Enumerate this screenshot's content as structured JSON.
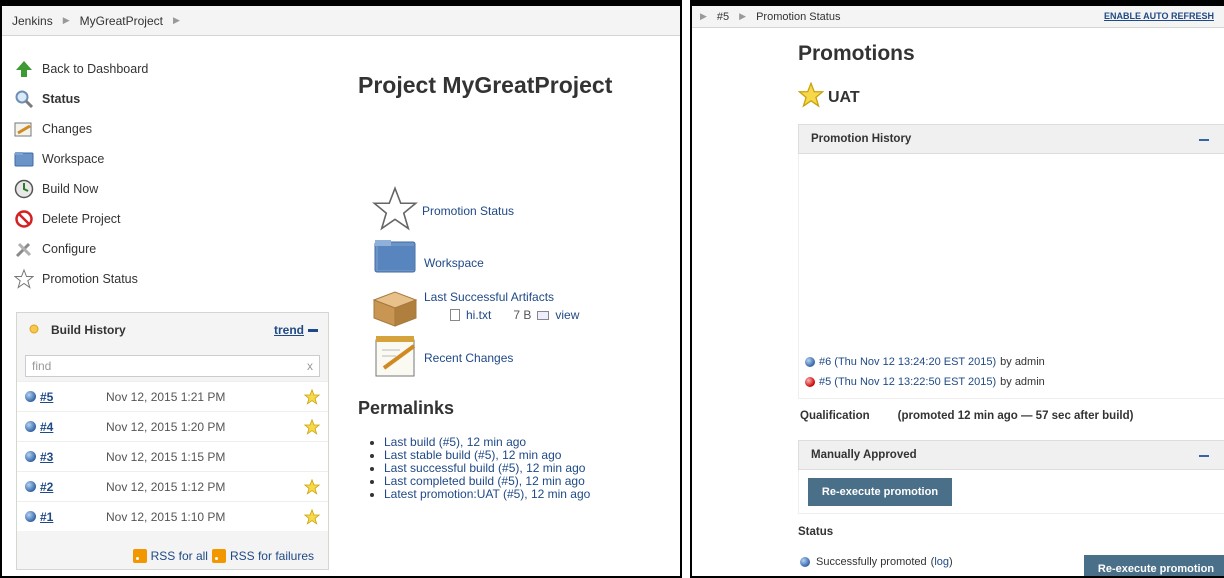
{
  "left": {
    "breadcrumb": [
      "Jenkins",
      "MyGreatProject"
    ],
    "menu": [
      {
        "label": "Back to Dashboard",
        "icon": "up-arrow-icon",
        "active": false
      },
      {
        "label": "Status",
        "icon": "magnifier-icon",
        "active": true
      },
      {
        "label": "Changes",
        "icon": "notepad-icon",
        "active": false
      },
      {
        "label": "Workspace",
        "icon": "folder-icon",
        "active": false
      },
      {
        "label": "Build Now",
        "icon": "clock-icon",
        "active": false
      },
      {
        "label": "Delete Project",
        "icon": "no-entry-icon",
        "active": false
      },
      {
        "label": "Configure",
        "icon": "wrench-icon",
        "active": false
      },
      {
        "label": "Promotion Status",
        "icon": "star-outline-icon",
        "active": false
      }
    ],
    "build_history": {
      "title": "Build History",
      "trend": "trend",
      "search_placeholder": "find",
      "search_clear": "x",
      "builds": [
        {
          "num": "#5",
          "date": "Nov 12, 2015 1:21 PM",
          "promoted": true
        },
        {
          "num": "#4",
          "date": "Nov 12, 2015 1:20 PM",
          "promoted": true
        },
        {
          "num": "#3",
          "date": "Nov 12, 2015 1:15 PM",
          "promoted": false
        },
        {
          "num": "#2",
          "date": "Nov 12, 2015 1:12 PM",
          "promoted": true
        },
        {
          "num": "#1",
          "date": "Nov 12, 2015 1:10 PM",
          "promoted": true
        }
      ],
      "rss_all": "RSS for all",
      "rss_failures": "RSS for failures"
    },
    "project_title": "Project MyGreatProject",
    "main_links": {
      "promotion_status": "Promotion Status",
      "workspace": "Workspace",
      "last_artifacts": "Last Successful Artifacts",
      "artifact_name": "hi.txt",
      "artifact_size": "7 B",
      "artifact_view": "view",
      "recent_changes": "Recent Changes"
    },
    "permalinks_title": "Permalinks",
    "permalinks": [
      "Last build (#5), 12 min ago",
      "Last stable build (#5), 12 min ago",
      "Last successful build (#5), 12 min ago",
      "Last completed build (#5), 12 min ago",
      "Latest promotion:UAT (#5), 12 min ago"
    ]
  },
  "right": {
    "breadcrumb": [
      "#5",
      "Promotion Status"
    ],
    "auto_refresh": "ENABLE AUTO REFRESH",
    "title": "Promotions",
    "promotion_name": "UAT",
    "history_title": "Promotion History",
    "history": [
      {
        "link": "#6 (Thu Nov 12 13:24:20 EST 2015)",
        "by": "by admin",
        "status": "blue"
      },
      {
        "link": "#5 (Thu Nov 12 13:22:50 EST 2015)",
        "by": "by admin",
        "status": "red"
      }
    ],
    "qualification_label": "Qualification",
    "qualification_value": "(promoted 12 min ago — 57 sec after build)",
    "manual_title": "Manually Approved",
    "reexecute_label": "Re-execute promotion",
    "status_title": "Status",
    "status_text": "Successfully promoted",
    "status_log": "log",
    "reexecute_label_2": "Re-execute promotion"
  }
}
